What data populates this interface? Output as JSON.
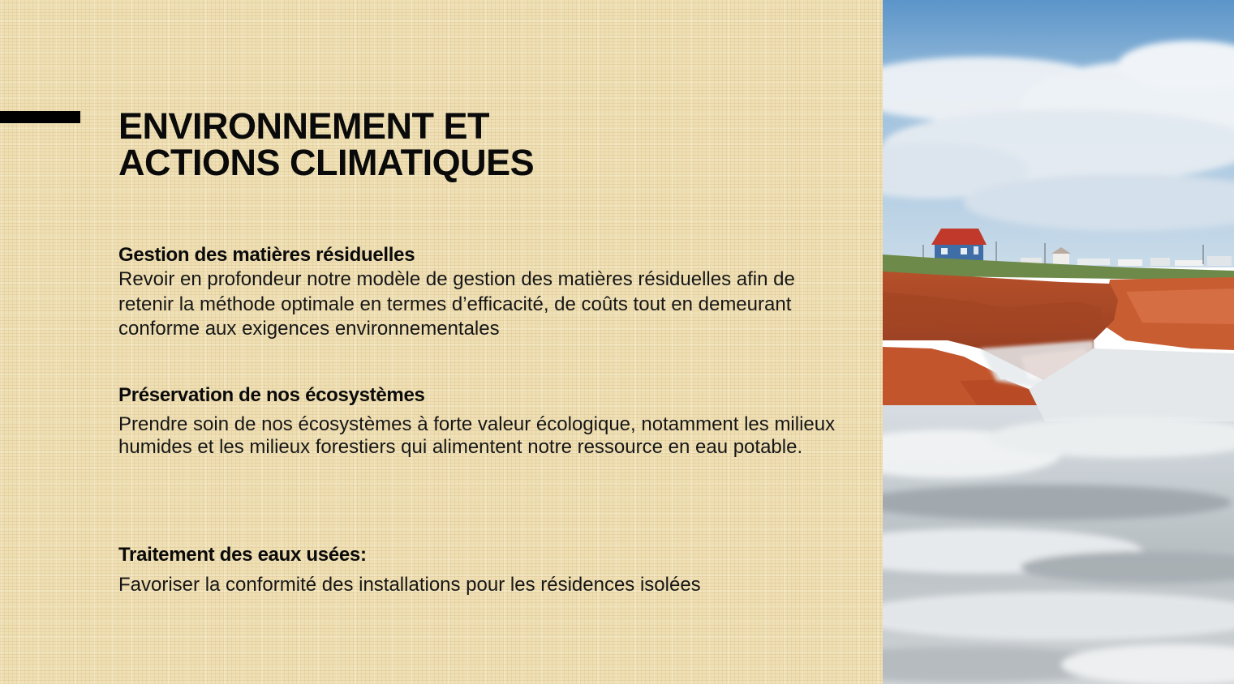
{
  "title": {
    "line1": "ENVIRONNEMENT ET",
    "line2": "ACTIONS CLIMATIQUES"
  },
  "sections": [
    {
      "heading": "Gestion des matières résiduelles",
      "body": "Revoir en profondeur notre modèle de gestion des matières résiduelles afin de retenir la méthode optimale en termes d’efficacité, de coûts tout en demeurant conforme aux exigences environnementales"
    },
    {
      "heading": "Préservation de nos écosystèmes",
      "body": "Prendre soin de nos écosystèmes à forte valeur écologique, notamment les milieux humides et les milieux forestiers qui alimentent notre ressource en eau potable."
    },
    {
      "heading": "Traitement des eaux usées:",
      "body": "Favoriser la conformité des installations pour les résidences isolées"
    }
  ],
  "colors": {
    "background": "#efdfb3",
    "accent_bar": "#000000",
    "text": "#0a0a0a"
  }
}
